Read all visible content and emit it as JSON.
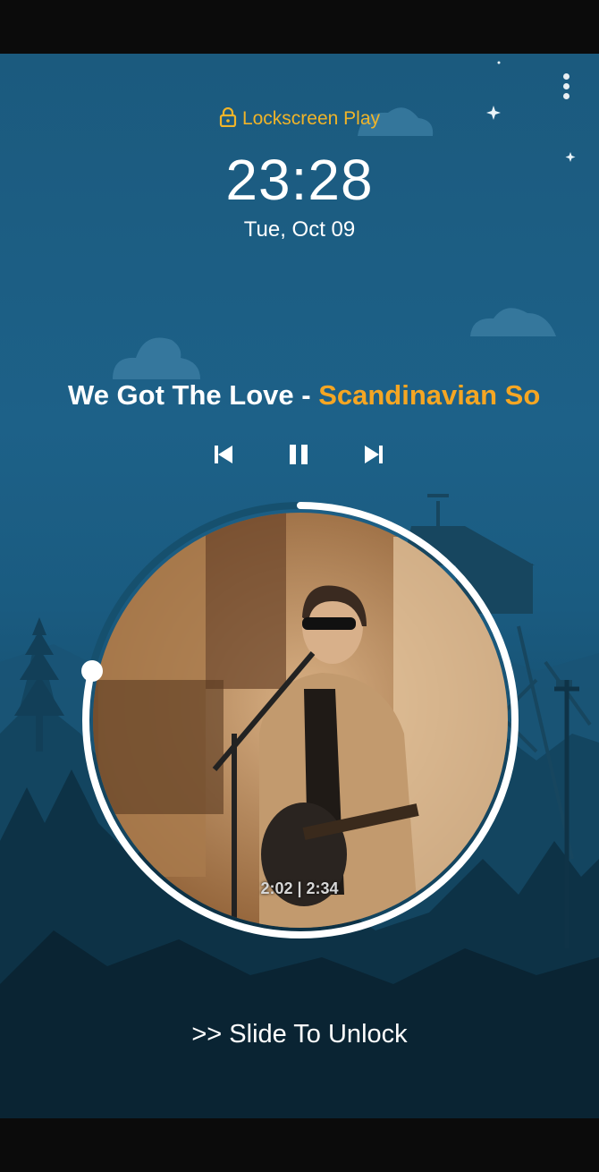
{
  "app": {
    "name": "Lockscreen Play"
  },
  "clock": {
    "time": "23:28",
    "date": "Tue, Oct 09"
  },
  "track": {
    "title": "We Got The Love",
    "separator": " - ",
    "artist": "Scandinavian So"
  },
  "playback": {
    "elapsed": "2:02",
    "total": "2:34",
    "time_label": "2:02 | 2:34",
    "progress": 0.792,
    "state": "playing"
  },
  "controls": {
    "previous": "previous-icon",
    "pause": "pause-icon",
    "next": "next-icon"
  },
  "menu": {
    "icon": "more-vertical-icon"
  },
  "unlock": {
    "label": ">> Slide To Unlock"
  },
  "colors": {
    "accent": "#f0b429",
    "artist": "#f5a623",
    "background": "#1b5a7e",
    "ring": "#ffffff"
  }
}
